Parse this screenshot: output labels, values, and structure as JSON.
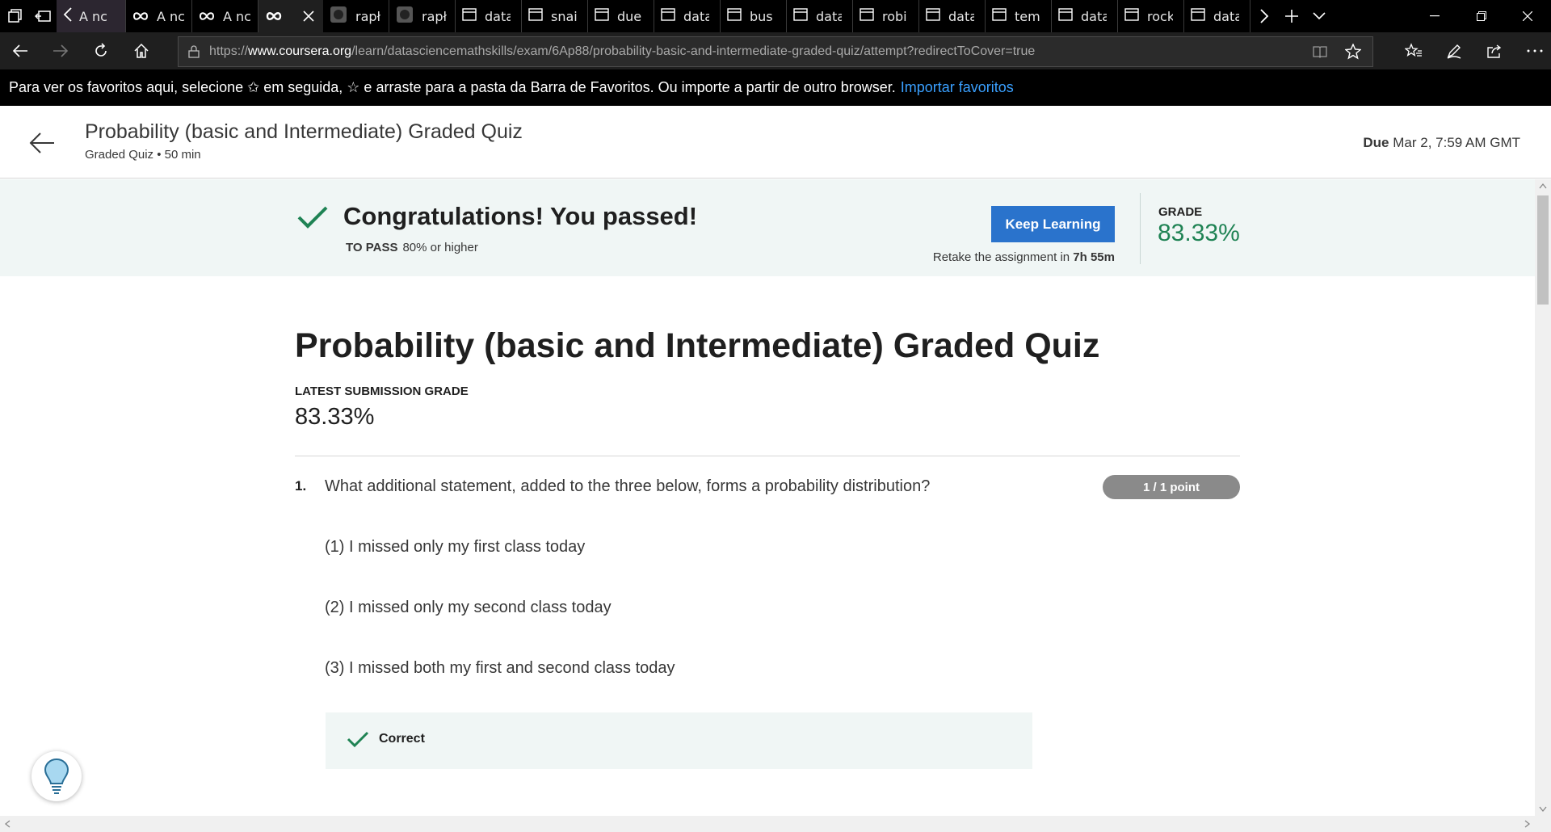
{
  "browser": {
    "tabs": [
      {
        "label": "A nc",
        "icon": "back-arrow-icon",
        "tinted": true
      },
      {
        "label": "A nc",
        "icon": "infinity-icon"
      },
      {
        "label": "A nc",
        "icon": "infinity-icon"
      },
      {
        "label": "",
        "icon": "infinity-icon",
        "active": true
      },
      {
        "label": "rapł",
        "icon": "github-icon"
      },
      {
        "label": "rapł",
        "icon": "github-icon"
      },
      {
        "label": "data",
        "icon": "page-icon"
      },
      {
        "label": "snai",
        "icon": "page-icon"
      },
      {
        "label": "due",
        "icon": "page-icon"
      },
      {
        "label": "data",
        "icon": "page-icon"
      },
      {
        "label": "bus",
        "icon": "page-icon"
      },
      {
        "label": "data",
        "icon": "page-icon"
      },
      {
        "label": "robi",
        "icon": "page-icon"
      },
      {
        "label": "data",
        "icon": "page-icon"
      },
      {
        "label": "tem",
        "icon": "page-icon"
      },
      {
        "label": "data",
        "icon": "page-icon"
      },
      {
        "label": "rock",
        "icon": "page-icon"
      },
      {
        "label": "data",
        "icon": "page-icon"
      }
    ],
    "url_prefix": "https://",
    "url_domain": "www.coursera.org",
    "url_path": "/learn/datasciencemathskills/exam/6Ap88/probability-basic-and-intermediate-graded-quiz/attempt?redirectToCover=true",
    "favorites_bar_text": "Para ver os favoritos aqui, selecione ✩ em seguida, ☆ e arraste para a pasta da Barra de Favoritos. Ou importe a partir de outro browser.",
    "favorites_bar_link": "Importar favoritos"
  },
  "header": {
    "title": "Probability (basic and Intermediate) Graded Quiz",
    "subtitle": "Graded Quiz • 50 min",
    "due_label": "Due",
    "due_value": "Mar 2, 7:59 AM GMT"
  },
  "banner": {
    "title": "Congratulations! You passed!",
    "to_pass_label": "TO PASS",
    "to_pass_value": "80% or higher",
    "button_label": "Keep Learning",
    "retake_prefix": "Retake the assignment in",
    "retake_time": "7h 55m",
    "grade_label": "GRADE",
    "grade_value": "83.33%"
  },
  "quiz": {
    "title": "Probability (basic and Intermediate) Graded Quiz",
    "latest_label": "LATEST SUBMISSION GRADE",
    "latest_value": "83.33%",
    "questions": [
      {
        "number": "1.",
        "text": "What additional statement, added to the three below, forms a probability distribution?",
        "points": "1 / 1 point",
        "statements": [
          "(1) I missed only my first class today",
          "(2) I missed only my second class today",
          "(3) I missed both my first and second class today"
        ],
        "feedback": "Correct"
      }
    ]
  },
  "colors": {
    "accent_blue": "#2a73cc",
    "success_green": "#1f8354",
    "banner_bg": "#f0f6f5"
  }
}
